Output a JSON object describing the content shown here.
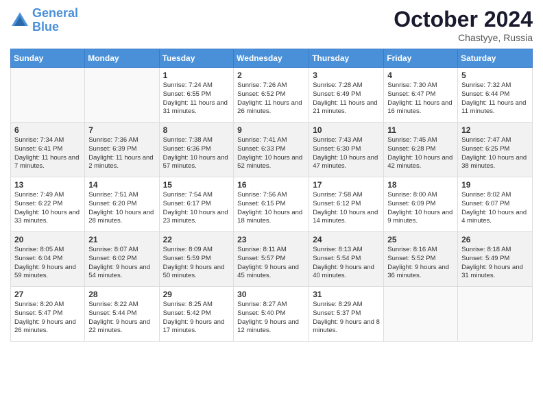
{
  "header": {
    "logo_line1": "General",
    "logo_line2": "Blue",
    "month": "October 2024",
    "location": "Chastyye, Russia"
  },
  "days_of_week": [
    "Sunday",
    "Monday",
    "Tuesday",
    "Wednesday",
    "Thursday",
    "Friday",
    "Saturday"
  ],
  "weeks": [
    {
      "shaded": false,
      "days": [
        {
          "num": "",
          "sunrise": "",
          "sunset": "",
          "daylight": ""
        },
        {
          "num": "",
          "sunrise": "",
          "sunset": "",
          "daylight": ""
        },
        {
          "num": "1",
          "sunrise": "Sunrise: 7:24 AM",
          "sunset": "Sunset: 6:55 PM",
          "daylight": "Daylight: 11 hours and 31 minutes."
        },
        {
          "num": "2",
          "sunrise": "Sunrise: 7:26 AM",
          "sunset": "Sunset: 6:52 PM",
          "daylight": "Daylight: 11 hours and 26 minutes."
        },
        {
          "num": "3",
          "sunrise": "Sunrise: 7:28 AM",
          "sunset": "Sunset: 6:49 PM",
          "daylight": "Daylight: 11 hours and 21 minutes."
        },
        {
          "num": "4",
          "sunrise": "Sunrise: 7:30 AM",
          "sunset": "Sunset: 6:47 PM",
          "daylight": "Daylight: 11 hours and 16 minutes."
        },
        {
          "num": "5",
          "sunrise": "Sunrise: 7:32 AM",
          "sunset": "Sunset: 6:44 PM",
          "daylight": "Daylight: 11 hours and 11 minutes."
        }
      ]
    },
    {
      "shaded": true,
      "days": [
        {
          "num": "6",
          "sunrise": "Sunrise: 7:34 AM",
          "sunset": "Sunset: 6:41 PM",
          "daylight": "Daylight: 11 hours and 7 minutes."
        },
        {
          "num": "7",
          "sunrise": "Sunrise: 7:36 AM",
          "sunset": "Sunset: 6:39 PM",
          "daylight": "Daylight: 11 hours and 2 minutes."
        },
        {
          "num": "8",
          "sunrise": "Sunrise: 7:38 AM",
          "sunset": "Sunset: 6:36 PM",
          "daylight": "Daylight: 10 hours and 57 minutes."
        },
        {
          "num": "9",
          "sunrise": "Sunrise: 7:41 AM",
          "sunset": "Sunset: 6:33 PM",
          "daylight": "Daylight: 10 hours and 52 minutes."
        },
        {
          "num": "10",
          "sunrise": "Sunrise: 7:43 AM",
          "sunset": "Sunset: 6:30 PM",
          "daylight": "Daylight: 10 hours and 47 minutes."
        },
        {
          "num": "11",
          "sunrise": "Sunrise: 7:45 AM",
          "sunset": "Sunset: 6:28 PM",
          "daylight": "Daylight: 10 hours and 42 minutes."
        },
        {
          "num": "12",
          "sunrise": "Sunrise: 7:47 AM",
          "sunset": "Sunset: 6:25 PM",
          "daylight": "Daylight: 10 hours and 38 minutes."
        }
      ]
    },
    {
      "shaded": false,
      "days": [
        {
          "num": "13",
          "sunrise": "Sunrise: 7:49 AM",
          "sunset": "Sunset: 6:22 PM",
          "daylight": "Daylight: 10 hours and 33 minutes."
        },
        {
          "num": "14",
          "sunrise": "Sunrise: 7:51 AM",
          "sunset": "Sunset: 6:20 PM",
          "daylight": "Daylight: 10 hours and 28 minutes."
        },
        {
          "num": "15",
          "sunrise": "Sunrise: 7:54 AM",
          "sunset": "Sunset: 6:17 PM",
          "daylight": "Daylight: 10 hours and 23 minutes."
        },
        {
          "num": "16",
          "sunrise": "Sunrise: 7:56 AM",
          "sunset": "Sunset: 6:15 PM",
          "daylight": "Daylight: 10 hours and 18 minutes."
        },
        {
          "num": "17",
          "sunrise": "Sunrise: 7:58 AM",
          "sunset": "Sunset: 6:12 PM",
          "daylight": "Daylight: 10 hours and 14 minutes."
        },
        {
          "num": "18",
          "sunrise": "Sunrise: 8:00 AM",
          "sunset": "Sunset: 6:09 PM",
          "daylight": "Daylight: 10 hours and 9 minutes."
        },
        {
          "num": "19",
          "sunrise": "Sunrise: 8:02 AM",
          "sunset": "Sunset: 6:07 PM",
          "daylight": "Daylight: 10 hours and 4 minutes."
        }
      ]
    },
    {
      "shaded": true,
      "days": [
        {
          "num": "20",
          "sunrise": "Sunrise: 8:05 AM",
          "sunset": "Sunset: 6:04 PM",
          "daylight": "Daylight: 9 hours and 59 minutes."
        },
        {
          "num": "21",
          "sunrise": "Sunrise: 8:07 AM",
          "sunset": "Sunset: 6:02 PM",
          "daylight": "Daylight: 9 hours and 54 minutes."
        },
        {
          "num": "22",
          "sunrise": "Sunrise: 8:09 AM",
          "sunset": "Sunset: 5:59 PM",
          "daylight": "Daylight: 9 hours and 50 minutes."
        },
        {
          "num": "23",
          "sunrise": "Sunrise: 8:11 AM",
          "sunset": "Sunset: 5:57 PM",
          "daylight": "Daylight: 9 hours and 45 minutes."
        },
        {
          "num": "24",
          "sunrise": "Sunrise: 8:13 AM",
          "sunset": "Sunset: 5:54 PM",
          "daylight": "Daylight: 9 hours and 40 minutes."
        },
        {
          "num": "25",
          "sunrise": "Sunrise: 8:16 AM",
          "sunset": "Sunset: 5:52 PM",
          "daylight": "Daylight: 9 hours and 36 minutes."
        },
        {
          "num": "26",
          "sunrise": "Sunrise: 8:18 AM",
          "sunset": "Sunset: 5:49 PM",
          "daylight": "Daylight: 9 hours and 31 minutes."
        }
      ]
    },
    {
      "shaded": false,
      "days": [
        {
          "num": "27",
          "sunrise": "Sunrise: 8:20 AM",
          "sunset": "Sunset: 5:47 PM",
          "daylight": "Daylight: 9 hours and 26 minutes."
        },
        {
          "num": "28",
          "sunrise": "Sunrise: 8:22 AM",
          "sunset": "Sunset: 5:44 PM",
          "daylight": "Daylight: 9 hours and 22 minutes."
        },
        {
          "num": "29",
          "sunrise": "Sunrise: 8:25 AM",
          "sunset": "Sunset: 5:42 PM",
          "daylight": "Daylight: 9 hours and 17 minutes."
        },
        {
          "num": "30",
          "sunrise": "Sunrise: 8:27 AM",
          "sunset": "Sunset: 5:40 PM",
          "daylight": "Daylight: 9 hours and 12 minutes."
        },
        {
          "num": "31",
          "sunrise": "Sunrise: 8:29 AM",
          "sunset": "Sunset: 5:37 PM",
          "daylight": "Daylight: 9 hours and 8 minutes."
        },
        {
          "num": "",
          "sunrise": "",
          "sunset": "",
          "daylight": ""
        },
        {
          "num": "",
          "sunrise": "",
          "sunset": "",
          "daylight": ""
        }
      ]
    }
  ]
}
